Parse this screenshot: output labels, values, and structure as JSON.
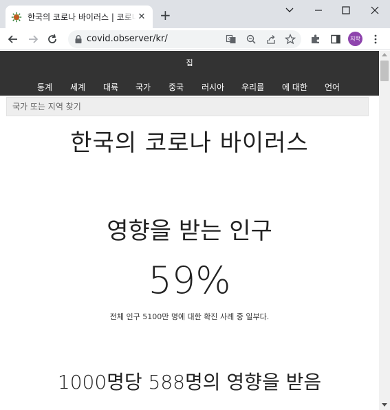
{
  "browser": {
    "tab_title": "한국의 코로나 바이러스 | 코로나",
    "tab_close": "✕",
    "new_tab": "+",
    "url": "covid.observer/kr/",
    "profile_label": "지학"
  },
  "site": {
    "home": "집",
    "nav": [
      "통계",
      "세계",
      "대륙",
      "국가",
      "중국",
      "러시아",
      "우리를",
      "에 대한",
      "언어"
    ],
    "search_placeholder": "국가 또는 지역 찾기"
  },
  "content": {
    "heading": "한국의 코로나 바이러스",
    "affected_heading": "영향을 받는 인구",
    "affected_percent": "59%",
    "affected_note": "전체 인구 5100만 명에 대한 확진 사례 중 일부다.",
    "per_thousand": "1000명당 588명의 영향을 받음"
  }
}
